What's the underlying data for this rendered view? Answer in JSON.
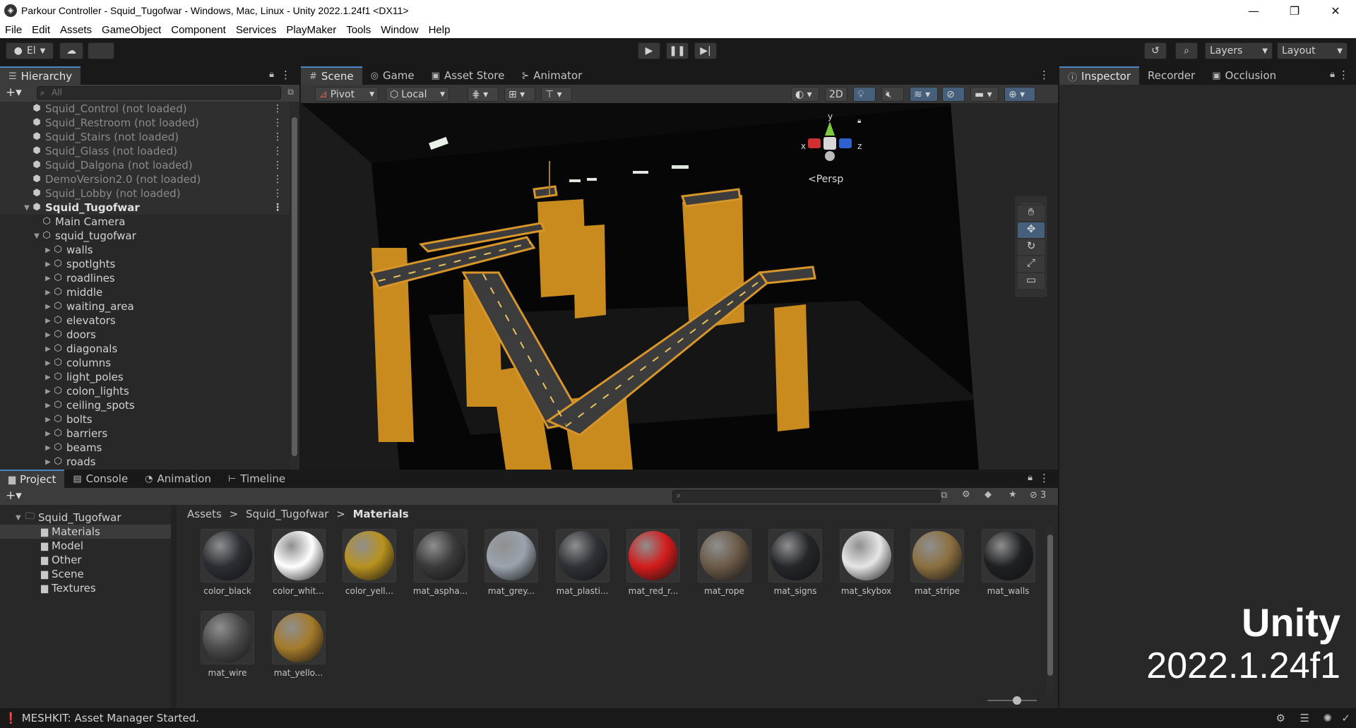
{
  "window": {
    "title": "Parkour Controller - Squid_Tugofwar - Windows, Mac, Linux - Unity 2022.1.24f1 <DX11>",
    "minimize": "—",
    "maximize": "❐",
    "close": "✕"
  },
  "menu": [
    "File",
    "Edit",
    "Assets",
    "GameObject",
    "Component",
    "Services",
    "PlayMaker",
    "Tools",
    "Window",
    "Help"
  ],
  "toolbar": {
    "account": "El",
    "layers": "Layers",
    "layout": "Layout"
  },
  "hierarchy": {
    "tab": "Hierarchy",
    "search_placeholder": "All",
    "items": [
      {
        "label": "Squid_Control (not loaded)",
        "indent": 0,
        "type": "scene-dim"
      },
      {
        "label": "Squid_Restroom (not loaded)",
        "indent": 0,
        "type": "scene-dim"
      },
      {
        "label": "Squid_Stairs (not loaded)",
        "indent": 0,
        "type": "scene-dim"
      },
      {
        "label": "Squid_Glass (not loaded)",
        "indent": 0,
        "type": "scene-dim"
      },
      {
        "label": "Squid_Dalgona (not loaded)",
        "indent": 0,
        "type": "scene-dim"
      },
      {
        "label": "DemoVersion2.0 (not loaded)",
        "indent": 0,
        "type": "scene-dim"
      },
      {
        "label": "Squid_Lobby (not loaded)",
        "indent": 0,
        "type": "scene-dim"
      },
      {
        "label": "Squid_Tugofwar",
        "indent": 0,
        "type": "scene-open"
      },
      {
        "label": "Main Camera",
        "indent": 1,
        "type": "obj"
      },
      {
        "label": "squid_tugofwar",
        "indent": 1,
        "type": "obj-open"
      },
      {
        "label": "walls",
        "indent": 2,
        "type": "obj-closed"
      },
      {
        "label": "spotlghts",
        "indent": 2,
        "type": "obj-closed"
      },
      {
        "label": "roadlines",
        "indent": 2,
        "type": "obj-closed"
      },
      {
        "label": "middle",
        "indent": 2,
        "type": "obj-closed"
      },
      {
        "label": "waiting_area",
        "indent": 2,
        "type": "obj-closed"
      },
      {
        "label": "elevators",
        "indent": 2,
        "type": "obj-closed"
      },
      {
        "label": "doors",
        "indent": 2,
        "type": "obj-closed"
      },
      {
        "label": "diagonals",
        "indent": 2,
        "type": "obj-closed"
      },
      {
        "label": "columns",
        "indent": 2,
        "type": "obj-closed"
      },
      {
        "label": "light_poles",
        "indent": 2,
        "type": "obj-closed"
      },
      {
        "label": "colon_lights",
        "indent": 2,
        "type": "obj-closed"
      },
      {
        "label": "ceiling_spots",
        "indent": 2,
        "type": "obj-closed"
      },
      {
        "label": "bolts",
        "indent": 2,
        "type": "obj-closed"
      },
      {
        "label": "barriers",
        "indent": 2,
        "type": "obj-closed"
      },
      {
        "label": "beams",
        "indent": 2,
        "type": "obj-closed"
      },
      {
        "label": "roads",
        "indent": 2,
        "type": "obj-closed"
      }
    ]
  },
  "scene_tabs": [
    "Scene",
    "Game",
    "Asset Store",
    "Animator"
  ],
  "scene_toolbar": {
    "pivot": "Pivot",
    "local": "Local",
    "mode_2d": "2D"
  },
  "gizmo": {
    "x": "x",
    "y": "y",
    "z": "z",
    "persp": "Persp"
  },
  "inspector_tabs": [
    "Inspector",
    "Recorder",
    "Occlusion"
  ],
  "bottom_tabs": [
    "Project",
    "Console",
    "Animation",
    "Timeline"
  ],
  "project": {
    "hidden_count": "3",
    "tree": [
      {
        "label": "Squid_Tugofwar",
        "indent": 0,
        "selected": false
      },
      {
        "label": "Materials",
        "indent": 1,
        "selected": true
      },
      {
        "label": "Model",
        "indent": 1,
        "selected": false
      },
      {
        "label": "Other",
        "indent": 1,
        "selected": false
      },
      {
        "label": "Scene",
        "indent": 1,
        "selected": false
      },
      {
        "label": "Textures",
        "indent": 1,
        "selected": false
      }
    ],
    "breadcrumb": [
      "Assets",
      "Squid_Tugofwar",
      "Materials"
    ],
    "assets": [
      {
        "label": "color_black",
        "color": "#2b2e33"
      },
      {
        "label": "color_whit...",
        "color": "#ffffff"
      },
      {
        "label": "color_yell...",
        "color": "#b8921f"
      },
      {
        "label": "mat_aspha...",
        "color": "#3a3a3a"
      },
      {
        "label": "mat_grey...",
        "color": "#9aa3ad"
      },
      {
        "label": "mat_plasti...",
        "color": "#2e3136"
      },
      {
        "label": "mat_red_r...",
        "color": "#d31c1c"
      },
      {
        "label": "mat_rope",
        "color": "#6b5a48"
      },
      {
        "label": "mat_signs",
        "color": "#25262a"
      },
      {
        "label": "mat_skybox",
        "color": "#e6e6e6"
      },
      {
        "label": "mat_stripe",
        "color": "#8c7040"
      },
      {
        "label": "mat_walls",
        "color": "#1f2022"
      },
      {
        "label": "mat_wire",
        "color": "#4a4a4a"
      },
      {
        "label": "mat_yello...",
        "color": "#a57a2a"
      }
    ]
  },
  "status": {
    "message": "MESHKIT: Asset Manager Started."
  },
  "watermark": {
    "line1": "Unity",
    "line2": "2022.1.24f1"
  }
}
